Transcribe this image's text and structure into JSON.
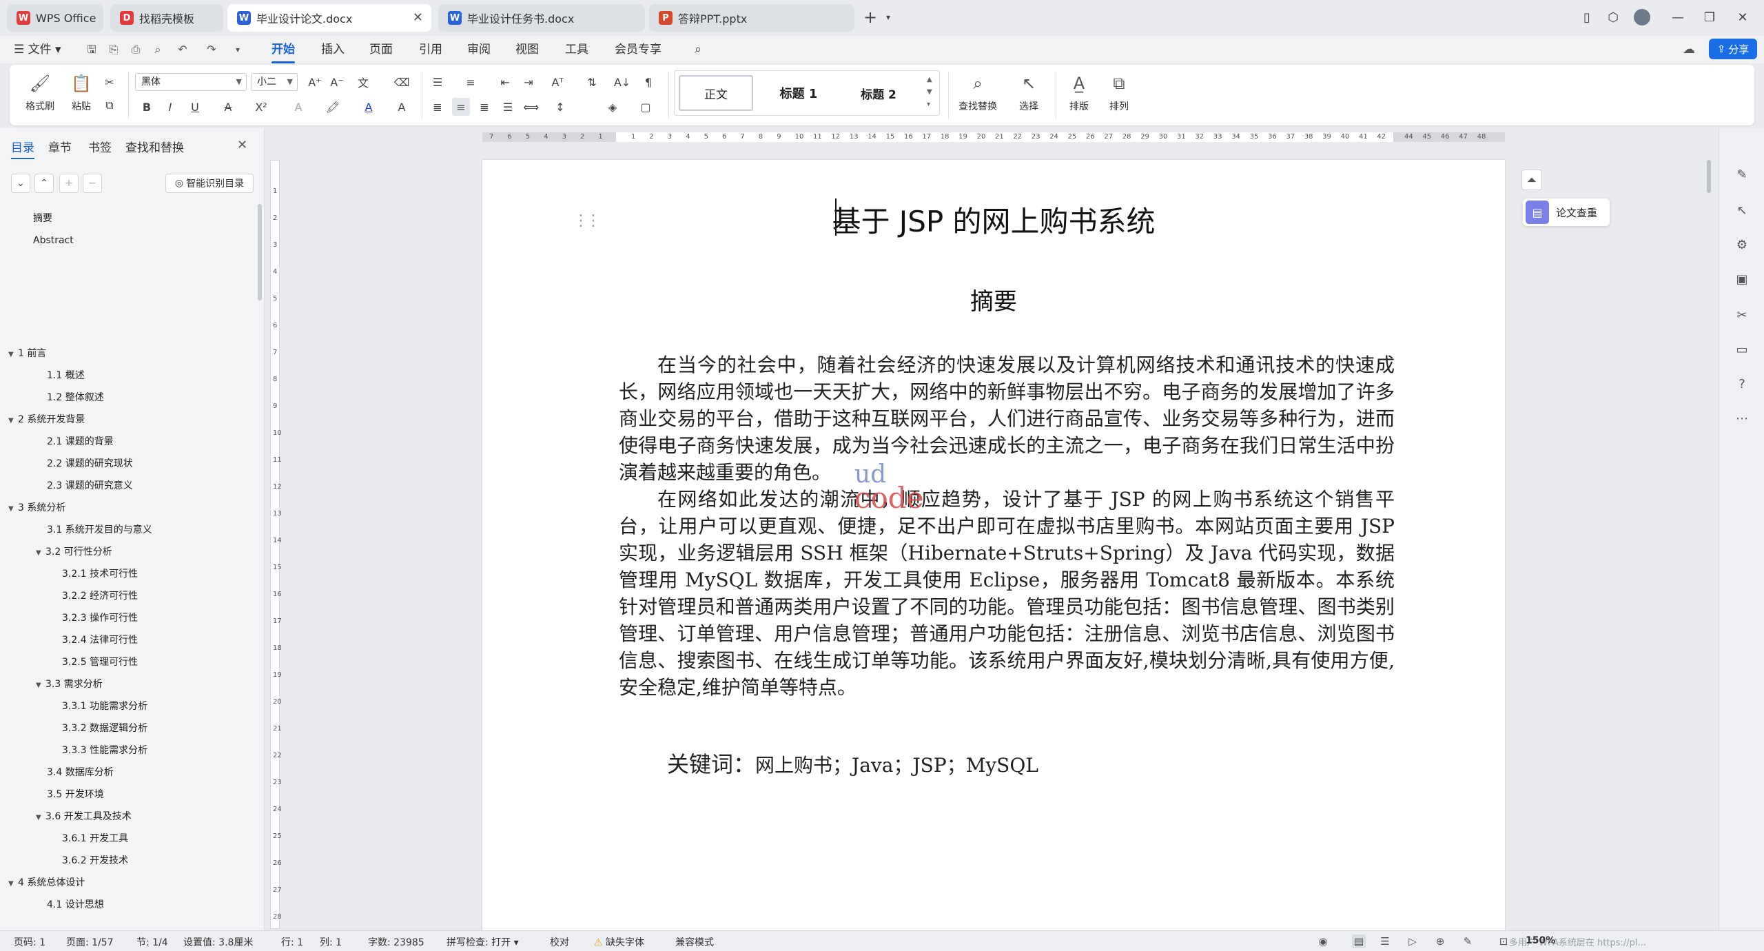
{
  "tabs": [
    {
      "label": "WPS Office",
      "icon": "W",
      "icon_color": "#e23b3b",
      "active": false
    },
    {
      "label": "找稻壳模板",
      "icon": "D",
      "icon_color": "#e23b3b",
      "active": false
    },
    {
      "label": "毕业设计论文.docx",
      "icon": "W",
      "icon_color": "#2a63d9",
      "active": true
    },
    {
      "label": "毕业设计任务书.docx",
      "icon": "W",
      "icon_color": "#2a63d9",
      "active": false
    },
    {
      "label": "答辩PPT.pptx",
      "icon": "P",
      "icon_color": "#d9482b",
      "active": false
    }
  ],
  "menu": {
    "file_label": "文件",
    "items": [
      "开始",
      "插入",
      "页面",
      "引用",
      "审阅",
      "视图",
      "工具",
      "会员专享"
    ],
    "share_label": "分享"
  },
  "ribbon": {
    "format_painter": "格式刷",
    "paste": "粘贴",
    "font_name": "黑体",
    "font_size": "小二",
    "styles": [
      "正文",
      "标题 1",
      "标题 2"
    ],
    "find_replace": "查找替换",
    "select": "选择",
    "layout": "排版",
    "arrange": "排列"
  },
  "nav": {
    "tabs": [
      "目录",
      "章节",
      "书签",
      "查找和替换"
    ],
    "smart_toc": "智能识别目录",
    "items": [
      {
        "label": "摘要",
        "level": 0,
        "arrow": ""
      },
      {
        "label": "Abstract",
        "level": 0,
        "arrow": ""
      },
      {
        "label": "1   前言",
        "level": 0,
        "arrow": "▼"
      },
      {
        "label": "1.1  概述",
        "level": 1,
        "arrow": ""
      },
      {
        "label": "1.2  整体叙述",
        "level": 1,
        "arrow": ""
      },
      {
        "label": "2   系统开发背景",
        "level": 0,
        "arrow": "▼"
      },
      {
        "label": "2.1  课题的背景",
        "level": 1,
        "arrow": ""
      },
      {
        "label": "2.2  课题的研究现状",
        "level": 1,
        "arrow": ""
      },
      {
        "label": "2.3  课题的研究意义",
        "level": 1,
        "arrow": ""
      },
      {
        "label": "3     系统分析",
        "level": 0,
        "arrow": "▼"
      },
      {
        "label": "3.1  系统开发目的与意义",
        "level": 1,
        "arrow": ""
      },
      {
        "label": "3.2  可行性分析",
        "level": 1,
        "arrow": "▼"
      },
      {
        "label": "3.2.1  技术可行性",
        "level": 2,
        "arrow": ""
      },
      {
        "label": "3.2.2  经济可行性",
        "level": 2,
        "arrow": ""
      },
      {
        "label": "3.2.3  操作可行性",
        "level": 2,
        "arrow": ""
      },
      {
        "label": "3.2.4  法律可行性",
        "level": 2,
        "arrow": ""
      },
      {
        "label": "3.2.5  管理可行性",
        "level": 2,
        "arrow": ""
      },
      {
        "label": "3.3  需求分析",
        "level": 1,
        "arrow": "▼"
      },
      {
        "label": "3.3.1  功能需求分析",
        "level": 2,
        "arrow": ""
      },
      {
        "label": "3.3.2  数据逻辑分析",
        "level": 2,
        "arrow": ""
      },
      {
        "label": "3.3.3  性能需求分析",
        "level": 2,
        "arrow": ""
      },
      {
        "label": "3.4     数据库分析",
        "level": 1,
        "arrow": ""
      },
      {
        "label": "3.5  开发环境",
        "level": 1,
        "arrow": ""
      },
      {
        "label": "3.6  开发工具及技术",
        "level": 1,
        "arrow": "▼"
      },
      {
        "label": "3.6.1  开发工具",
        "level": 2,
        "arrow": ""
      },
      {
        "label": "3.6.2  开发技术",
        "level": 2,
        "arrow": ""
      },
      {
        "label": "4   系统总体设计",
        "level": 0,
        "arrow": "▼"
      },
      {
        "label": "4.1  设计思想",
        "level": 1,
        "arrow": ""
      }
    ]
  },
  "ruler": {
    "h_left_ticks": [
      "7",
      "6",
      "5",
      "4",
      "3",
      "2",
      "1"
    ],
    "h_ticks": [
      "1",
      "2",
      "3",
      "4",
      "5",
      "6",
      "7",
      "8",
      "9",
      "10",
      "11",
      "12",
      "13",
      "14",
      "15",
      "16",
      "17",
      "18",
      "19",
      "20",
      "21",
      "22",
      "23",
      "24",
      "25",
      "26",
      "27",
      "28",
      "29",
      "30",
      "31",
      "32",
      "33",
      "34",
      "35",
      "36",
      "37",
      "38",
      "39",
      "40",
      "41",
      "42"
    ],
    "h_right_ticks": [
      "44",
      "45",
      "46",
      "47",
      "48"
    ],
    "v_ticks": [
      "1",
      "2",
      "3",
      "4",
      "5",
      "6",
      "7",
      "8",
      "9",
      "10",
      "11",
      "12",
      "13",
      "14",
      "15",
      "16",
      "17",
      "18",
      "19",
      "20",
      "21",
      "22",
      "23",
      "24",
      "25",
      "26",
      "27",
      "28"
    ]
  },
  "document": {
    "title": "基于 JSP 的网上购书系统",
    "abstract_heading": "摘要",
    "paragraph1": "在当今的社会中，随着社会经济的快速发展以及计算机网络技术和通讯技术的快速成长，网络应用领域也一天天扩大，网络中的新鲜事物层出不穷。电子商务的发展增加了许多商业交易的平台，借助于这种互联网平台，人们进行商品宣传、业务交易等多种行为，进而使得电子商务快速发展，成为当今社会迅速成长的主流之一，电子商务在我们日常生活中扮演着越来越重要的角色。",
    "paragraph2": "在网络如此发达的潮流中，顺应趋势，设计了基于 JSP 的网上购书系统这个销售平台，让用户可以更直观、便捷，足不出户即可在虚拟书店里购书。本网站页面主要用 JSP 实现，业务逻辑层用 SSH 框架（Hibernate+Struts+Spring）及 Java 代码实现，数据管理用 MySQL 数据库，开发工具使用 Eclipse，服务器用 Tomcat8 最新版本。本系统针对管理员和普通两类用户设置了不同的功能。管理员功能包括：图书信息管理、图书类别管理、订单管理、用户信息管理；普通用户功能包括：注册信息、浏览书店信息、浏览图书信息、搜索图书、在线生成订单等功能。该系统用户界面友好,模块划分清晰,具有使用方便,安全稳定,维护简单等特点。",
    "keywords_label": "关键词：",
    "keywords": "网上购书；Java；JSP；MySQL",
    "watermark_top": "ud",
    "watermark_bottom": "code"
  },
  "side": {
    "thesis_check": "论文查重"
  },
  "status": {
    "page_num": "页码: 1",
    "page": "页面: 1/57",
    "section": "节: 1/4",
    "setting": "设置值: 3.8厘米",
    "row": "行: 1",
    "col": "列: 1",
    "words": "字数: 23985",
    "spell": "拼写检查: 打开",
    "proof": "校对",
    "missing_font": "缺失字体",
    "compat": "兼容模式",
    "zoom": "150%",
    "overlay_text": "多用户 WPA系统层在 https://pl..."
  }
}
